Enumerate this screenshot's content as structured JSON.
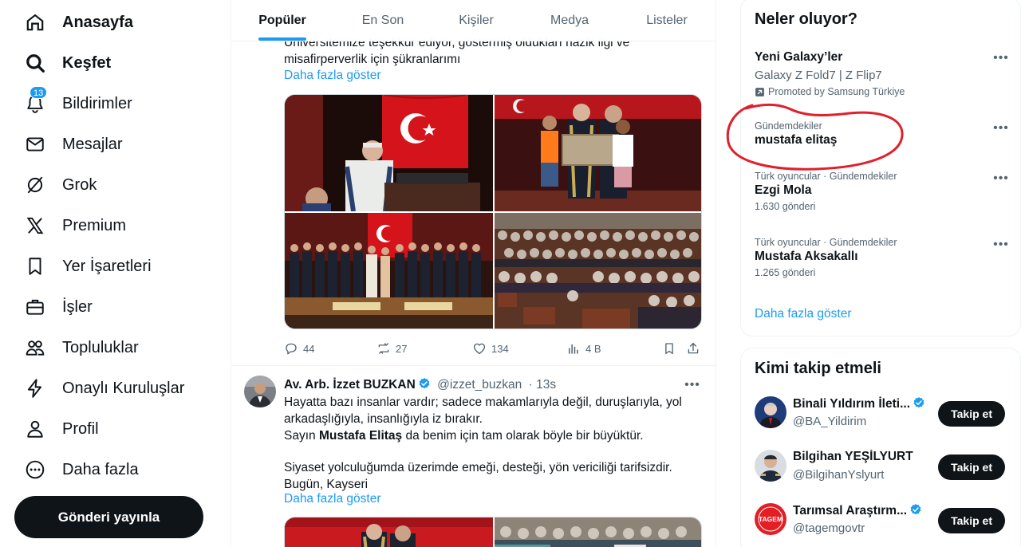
{
  "nav": {
    "home": "Anasayfa",
    "explore": "Keşfet",
    "notifications": "Bildirimler",
    "notifications_badge": "13",
    "messages": "Mesajlar",
    "grok": "Grok",
    "premium": "Premium",
    "bookmarks": "Yer İşaretleri",
    "jobs": "İşler",
    "communities": "Topluluklar",
    "verified_orgs": "Onaylı Kuruluşlar",
    "profile": "Profil",
    "more": "Daha fazla",
    "post_button": "Gönderi yayınla"
  },
  "tabs": [
    "Popüler",
    "En Son",
    "Kişiler",
    "Medya",
    "Listeler"
  ],
  "tweet1": {
    "text_line1": "Üniversitemize teşekkür ediyor, göstermiş oldukları nazik ilgi ve",
    "text_line2": "misafirperverlik için şükranlarımı",
    "show_more": "Daha fazla göster",
    "replies": "44",
    "reposts": "27",
    "likes": "134",
    "views": "4 B"
  },
  "tweet2": {
    "name": "Av. Arb. İzzet BUZKAN",
    "handle": "@izzet_buzkan",
    "time": "· 13s",
    "line1": "Hayatta bazı insanlar vardır; sadece makamlarıyla değil, duruşlarıyla, yol",
    "line2": "arkadaşlığıyla, insanlığıyla iz bırakır.",
    "line3_pre": "Sayın ",
    "line3_bold": "Mustafa Elitaş",
    "line3_post": " da benim için tam olarak böyle bir büyüktür.",
    "line4": "Siyaset yolculuğumda üzerimde emeği, desteği, yön vericiliği tarifsizdir.",
    "line5": "Bugün, Kayseri",
    "show_more": "Daha fazla göster"
  },
  "trends": {
    "title": "Neler oluyor?",
    "promoted": {
      "name": "Yeni Galaxy’ler",
      "sub": "Galaxy Z Fold7 | Z Flip7",
      "promoted_by": "Promoted by Samsung Türkiye"
    },
    "items": [
      {
        "context": "Gündemdekiler",
        "name": "mustafa elitaş",
        "count": ""
      },
      {
        "context": "Türk oyuncular · Gündemdekiler",
        "name": "Ezgi Mola",
        "count": "1.630 gönderi"
      },
      {
        "context": "Türk oyuncular · Gündemdekiler",
        "name": "Mustafa Aksakallı",
        "count": "1.265 gönderi"
      }
    ],
    "show_more": "Daha fazla göster"
  },
  "who_to_follow": {
    "title": "Kimi takip etmeli",
    "items": [
      {
        "name": "Binali Yıldırım İleti...",
        "handle": "@BA_Yildirim",
        "button": "Takip et"
      },
      {
        "name": "Bilgihan YEŞİLYURT",
        "handle": "@BilgihanYslyurt",
        "button": "Takip et"
      },
      {
        "name": "Tarımsal Araştırm...",
        "handle": "@tagemgovtr",
        "button": "Takip et"
      }
    ],
    "tagem_logo_text": "TAGEM"
  },
  "colors": {
    "accent": "#1d9bf0",
    "text": "#0f1419",
    "muted": "#536471",
    "annotation_red": "#e0202a"
  }
}
